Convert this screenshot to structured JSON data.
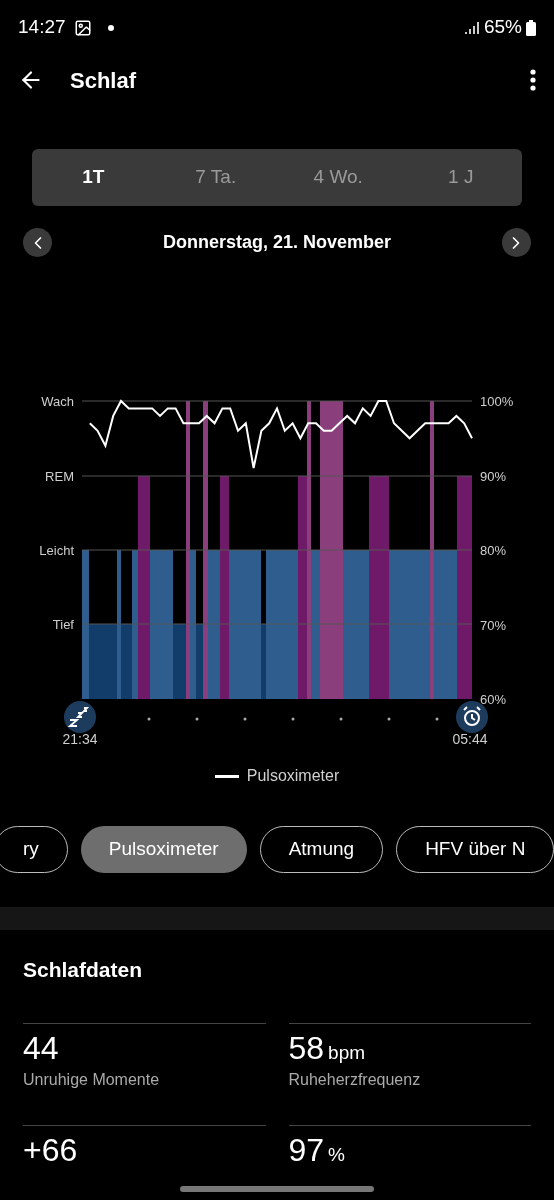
{
  "status_bar": {
    "time": "14:27",
    "battery": "65%"
  },
  "header": {
    "title": "Schlaf"
  },
  "period_tabs": [
    {
      "label": "1T",
      "selected": true
    },
    {
      "label": "7 Ta.",
      "selected": false
    },
    {
      "label": "4 Wo.",
      "selected": false
    },
    {
      "label": "1 J",
      "selected": false
    }
  ],
  "date_nav": {
    "date": "Donnerstag, 21. November"
  },
  "stage_labels": [
    "Wach",
    "REM",
    "Leicht",
    "Tief"
  ],
  "chart_data": {
    "type": "line",
    "categories": [
      "21:34",
      null,
      null,
      null,
      null,
      null,
      null,
      null,
      null,
      null,
      null,
      null,
      null,
      null,
      null,
      null,
      null,
      null,
      null,
      null,
      null,
      null,
      null,
      null,
      null,
      null,
      null,
      null,
      null,
      null,
      null,
      null,
      null,
      null,
      null,
      null,
      null,
      null,
      null,
      null,
      null,
      null,
      null,
      null,
      null,
      null,
      null,
      null,
      null,
      null,
      "05:44"
    ],
    "series": [
      {
        "name": "Pulsoximeter",
        "color": "#ffffff",
        "values": [
          null,
          97,
          96,
          94,
          98,
          100,
          99,
          99,
          99,
          99,
          98,
          99,
          99,
          97,
          97,
          97,
          98,
          97,
          99,
          99,
          96,
          97,
          91,
          96,
          97,
          99,
          96,
          97,
          95,
          97,
          97,
          96,
          96,
          97,
          98,
          97,
          99,
          98,
          100,
          100,
          97,
          96,
          95,
          96,
          97,
          97,
          97,
          97,
          98,
          97,
          95
        ]
      }
    ],
    "ylim": [
      60,
      100
    ],
    "grid": true,
    "yticks": [
      {
        "value": 100,
        "label": "100%"
      },
      {
        "value": 90,
        "label": "90%"
      },
      {
        "value": 80,
        "label": "80%"
      },
      {
        "value": 70,
        "label": "70%"
      },
      {
        "value": 60,
        "label": "60%"
      }
    ]
  },
  "metric_chips": [
    {
      "label": "ry",
      "selected": false
    },
    {
      "label": "Pulsoximeter",
      "selected": true
    },
    {
      "label": "Atmung",
      "selected": false
    },
    {
      "label": "HFV über N",
      "selected": false
    }
  ],
  "sleep_data": {
    "title": "Schlafdaten",
    "stats": [
      {
        "value": "44",
        "label": "Unruhige Momente"
      },
      {
        "value": "58",
        "unit": "bpm",
        "label": "Ruheherzfrequenz"
      },
      {
        "value": "+66"
      },
      {
        "value": "97",
        "unit": "%"
      }
    ]
  }
}
